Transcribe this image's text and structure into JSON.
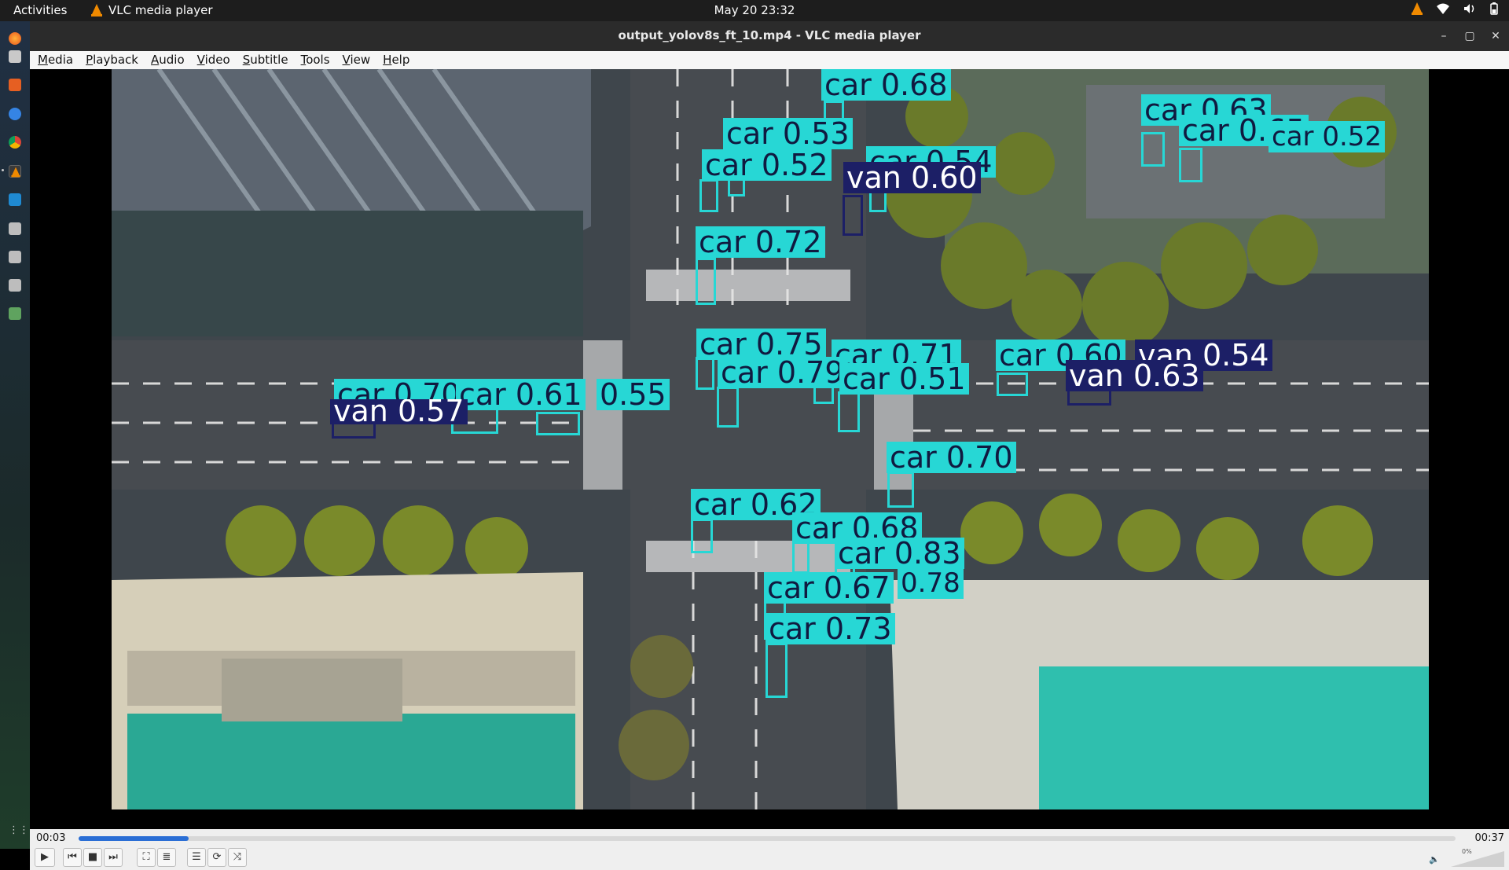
{
  "topbar": {
    "activities": "Activities",
    "app_name": "VLC media player",
    "clock": "May 20  23:32",
    "tray_icons": [
      "vlc-tray-icon",
      "wifi-icon",
      "volume-icon",
      "battery-icon"
    ]
  },
  "dock": {
    "apps": [
      "firefox-icon",
      "files-icon",
      "software-icon",
      "help-icon",
      "chrome-icon",
      "vlc-icon",
      "vscode-icon",
      "disk-icon",
      "disk-icon",
      "disk-icon",
      "trash-icon"
    ],
    "show_apps": "show-apps-icon"
  },
  "window": {
    "title": "output_yolov8s_ft_10.mp4 - VLC media player",
    "controls": [
      "minimize-icon",
      "maximize-icon",
      "close-icon"
    ]
  },
  "menu": [
    "Media",
    "Playback",
    "Audio",
    "Video",
    "Subtitle",
    "Tools",
    "View",
    "Help"
  ],
  "detections": [
    {
      "label": "car 0.68",
      "cls": "car"
    },
    {
      "label": "car 0.53",
      "cls": "car"
    },
    {
      "label": "car 0.52",
      "cls": "car"
    },
    {
      "label": "car 0.54",
      "cls": "car"
    },
    {
      "label": "van 0.60",
      "cls": "van"
    },
    {
      "label": "car 0.63",
      "cls": "car"
    },
    {
      "label": "car 0.65",
      "cls": "car"
    },
    {
      "label": "car 0.52",
      "cls": "car"
    },
    {
      "label": "car 0.72",
      "cls": "car"
    },
    {
      "label": "car 0.75",
      "cls": "car"
    },
    {
      "label": "car 0.71",
      "cls": "car"
    },
    {
      "label": "car 0.79",
      "cls": "car"
    },
    {
      "label": "car 0.51",
      "cls": "car"
    },
    {
      "label": "car 0.60",
      "cls": "car"
    },
    {
      "label": "van 0.54",
      "cls": "van"
    },
    {
      "label": "van 0.63",
      "cls": "van"
    },
    {
      "label": "car 0.70",
      "cls": "car"
    },
    {
      "label": "car 0.61",
      "cls": "car"
    },
    {
      "label": "0.55",
      "cls": "car"
    },
    {
      "label": "van 0.57",
      "cls": "van"
    },
    {
      "label": "car 0.70",
      "cls": "car"
    },
    {
      "label": "car 0.62",
      "cls": "car"
    },
    {
      "label": "car 0.68",
      "cls": "car"
    },
    {
      "label": "car 0.83",
      "cls": "car"
    },
    {
      "label": "car 0.67",
      "cls": "car"
    },
    {
      "label": "0.78",
      "cls": "car"
    },
    {
      "label": "car 0.73",
      "cls": "car"
    }
  ],
  "player": {
    "time_elapsed": "00:03",
    "time_total": "00:37",
    "progress": 0.08,
    "volume_text": "0%",
    "buttons": [
      "play-icon",
      "previous-icon",
      "stop-icon",
      "next-icon",
      "fullscreen-icon",
      "extended-settings-icon",
      "playlist-icon",
      "loop-icon",
      "shuffle-icon"
    ]
  },
  "colors": {
    "car_box": "#27d7d5",
    "van_box": "#1c1f66",
    "seek_fill": "#2a6ed5"
  }
}
